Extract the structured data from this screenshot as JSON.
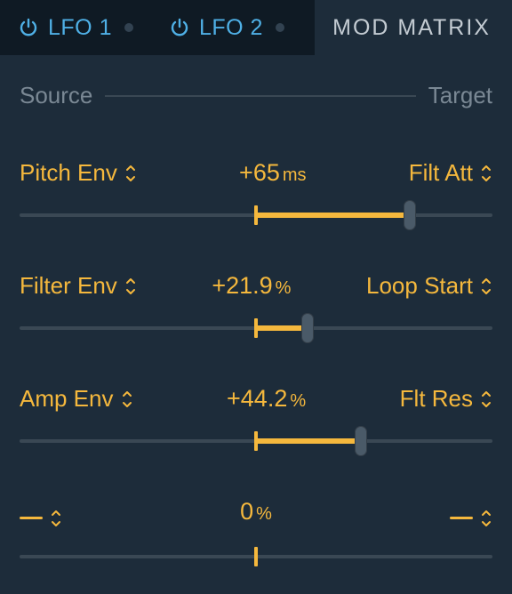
{
  "tabs": {
    "lfo1": {
      "label": "LFO 1"
    },
    "lfo2": {
      "label": "LFO 2"
    },
    "modmatrix": {
      "label": "MOD MATRIX"
    }
  },
  "header": {
    "source": "Source",
    "target": "Target"
  },
  "rows": [
    {
      "source": "Pitch Env",
      "target": "Filt Att",
      "value_text": "+65",
      "unit": "ms",
      "percent": 65
    },
    {
      "source": "Filter Env",
      "target": "Loop Start",
      "value_text": "+21.9",
      "unit": "%",
      "percent": 21.9
    },
    {
      "source": "Amp Env",
      "target": "Flt Res",
      "value_text": "+44.2",
      "unit": "%",
      "percent": 44.2
    },
    {
      "source": "",
      "target": "",
      "value_text": "0",
      "unit": "%",
      "percent": 0
    }
  ],
  "colors": {
    "amber": "#f5b83d",
    "cyan": "#4fb0e6",
    "background": "#1d2c3a"
  }
}
